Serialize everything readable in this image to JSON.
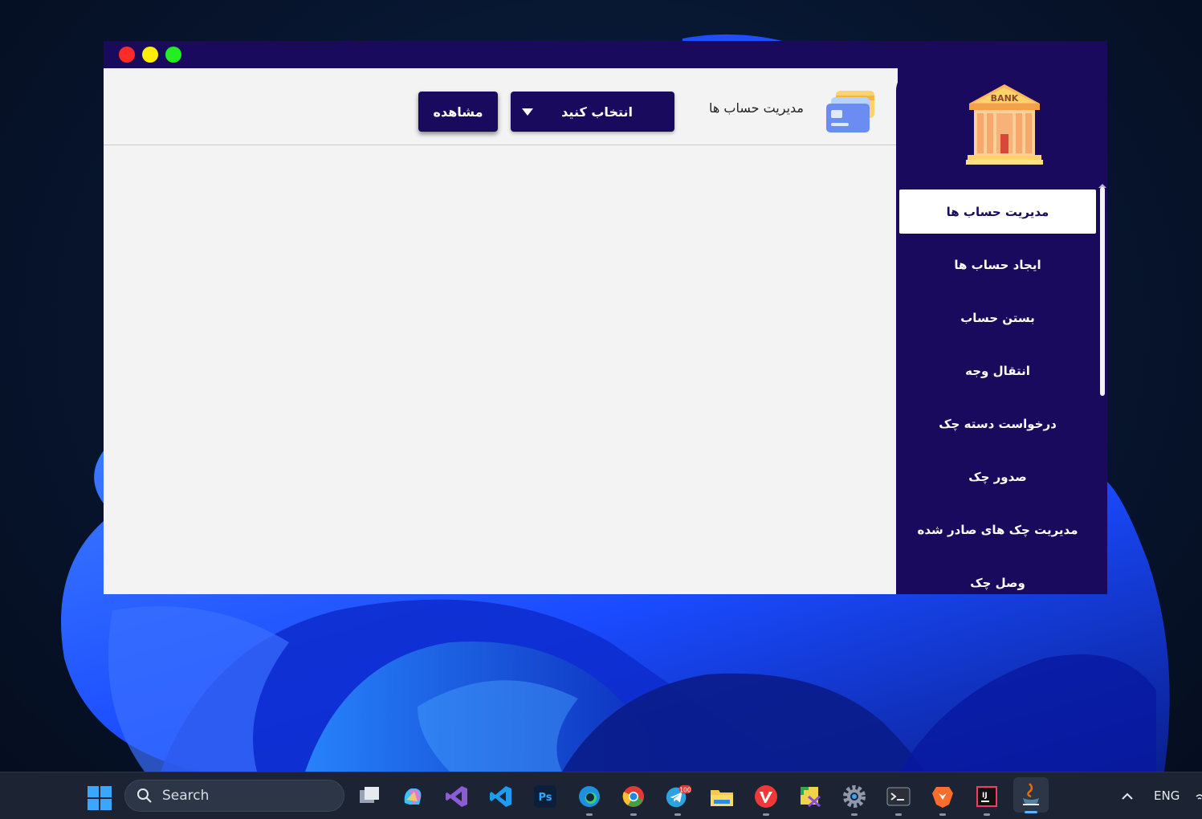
{
  "window": {
    "controls": [
      "close",
      "minimize",
      "maximize"
    ]
  },
  "header": {
    "view_button": "مشاهده",
    "select_value": "انتخاب کنید",
    "page_title": "مدیریت حساب ها",
    "cards_icon": "cards-icon"
  },
  "sidebar": {
    "logo_text": "BANK",
    "items": [
      {
        "label": "مدیریت حساب ها",
        "active": true
      },
      {
        "label": "ایجاد حساب ها",
        "active": false
      },
      {
        "label": "بستن حساب",
        "active": false
      },
      {
        "label": "انتقال وجه",
        "active": false
      },
      {
        "label": "درخواست دسته چک",
        "active": false
      },
      {
        "label": "صدور چک",
        "active": false
      },
      {
        "label": "مدیریت چک های صادر شده",
        "active": false
      },
      {
        "label": "وصل چک",
        "active": false
      }
    ]
  },
  "taskbar": {
    "search_placeholder": "Search",
    "language": "ENG",
    "telegram_badge": "100",
    "apps": [
      "task-view",
      "copilot",
      "visual-studio",
      "vscode",
      "photoshop",
      "edge",
      "chrome",
      "telegram",
      "file-explorer",
      "vivaldi",
      "snipping-tool",
      "settings",
      "terminal",
      "brave",
      "intellij",
      "java"
    ]
  },
  "colors": {
    "primary": "#1a0a5e",
    "content_bg": "#f3f3f3",
    "close": "#ff2b2b",
    "minimize": "#ffee00",
    "maximize": "#22ee22"
  }
}
